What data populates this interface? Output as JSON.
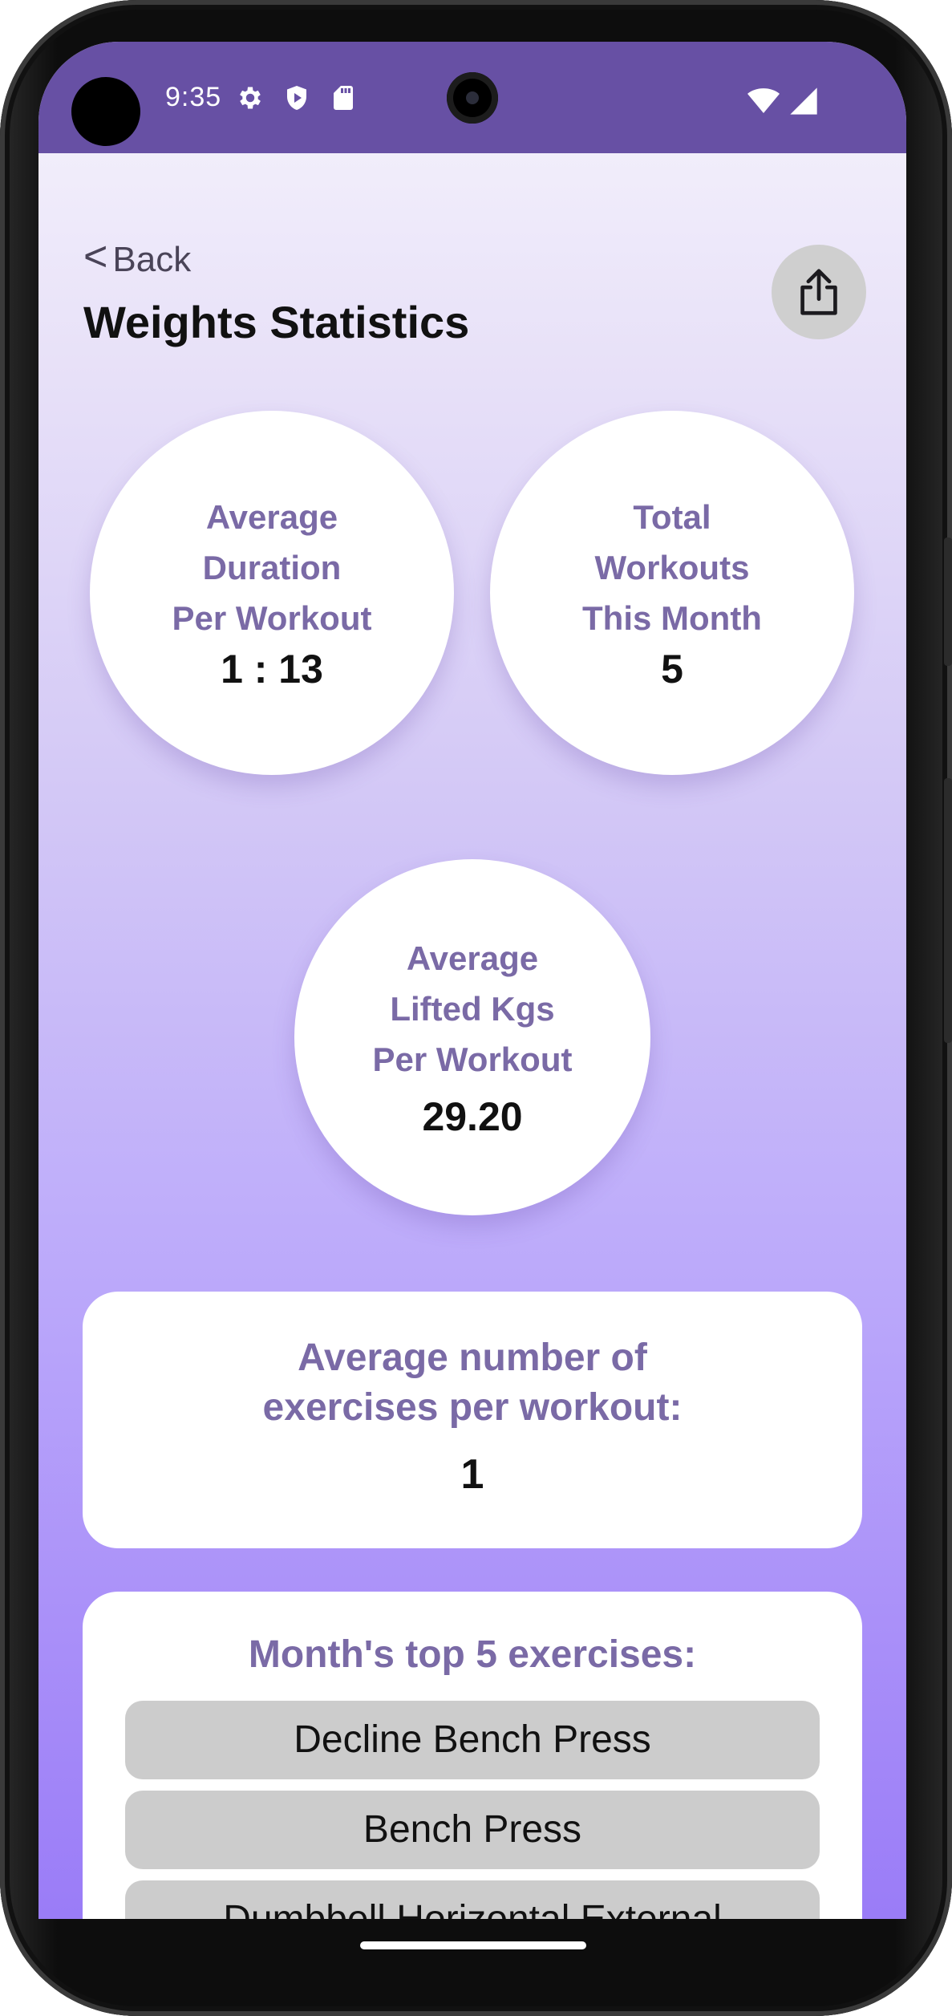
{
  "status_bar": {
    "time": "9:35",
    "icons": [
      "gear-icon",
      "shield-play-icon",
      "sd-card-icon"
    ],
    "right_icons": [
      "wifi-icon",
      "signal-icon"
    ],
    "color": "#6750a4"
  },
  "header": {
    "back_chevron": "<",
    "back_label": "Back",
    "title": "Weights Statistics",
    "share_icon": "share-icon"
  },
  "stats": {
    "avg_duration": {
      "label": "Average\nDuration\nPer Workout",
      "value": "1 : 13"
    },
    "total_workouts": {
      "label": "Total\nWorkouts\nThis Month",
      "value": "5"
    },
    "avg_lifted": {
      "label": "Average\nLifted Kgs\nPer Workout",
      "value": "29.20"
    }
  },
  "exercises_card": {
    "title": "Average number of\nexercises per workout:",
    "value": "1"
  },
  "top_exercises": {
    "title": "Month's top 5 exercises:",
    "items": [
      "Decline Bench Press",
      "Bench Press",
      "Dumbbell Horizontal External"
    ]
  },
  "colors": {
    "accent": "#7a6aa6",
    "status_bar": "#6750a4",
    "item_bg": "#cccccc"
  }
}
